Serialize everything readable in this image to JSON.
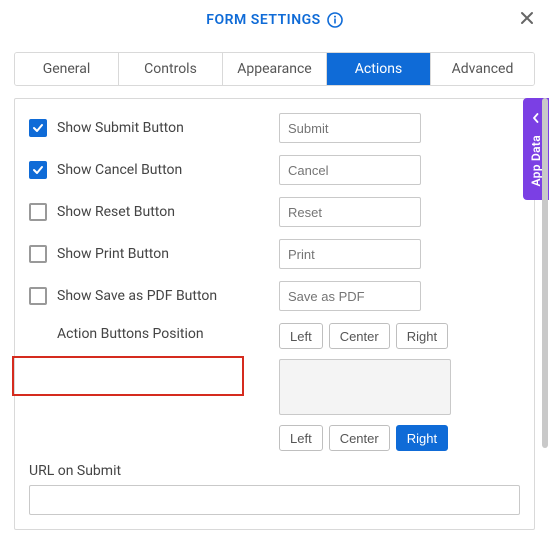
{
  "header": {
    "title": "FORM SETTINGS"
  },
  "tabs": [
    {
      "label": "General",
      "active": false
    },
    {
      "label": "Controls",
      "active": false
    },
    {
      "label": "Appearance",
      "active": false
    },
    {
      "label": "Actions",
      "active": true
    },
    {
      "label": "Advanced",
      "active": false
    }
  ],
  "actions": {
    "submit": {
      "label": "Show Submit Button",
      "checked": true,
      "placeholder": "Submit"
    },
    "cancel": {
      "label": "Show Cancel Button",
      "checked": true,
      "placeholder": "Cancel"
    },
    "reset": {
      "label": "Show Reset Button",
      "checked": false,
      "placeholder": "Reset"
    },
    "print": {
      "label": "Show Print Button",
      "checked": false,
      "placeholder": "Print"
    },
    "pdf": {
      "label": "Show Save as PDF Button",
      "checked": false,
      "placeholder": "Save as PDF"
    }
  },
  "position": {
    "label": "Action Buttons Position",
    "group1": {
      "left": "Left",
      "center": "Center",
      "right": "Right",
      "active": ""
    },
    "group2": {
      "left": "Left",
      "center": "Center",
      "right": "Right",
      "active": "right"
    }
  },
  "url_on_submit": {
    "label": "URL on Submit",
    "value": ""
  },
  "sidebar": {
    "label": "App Data"
  }
}
